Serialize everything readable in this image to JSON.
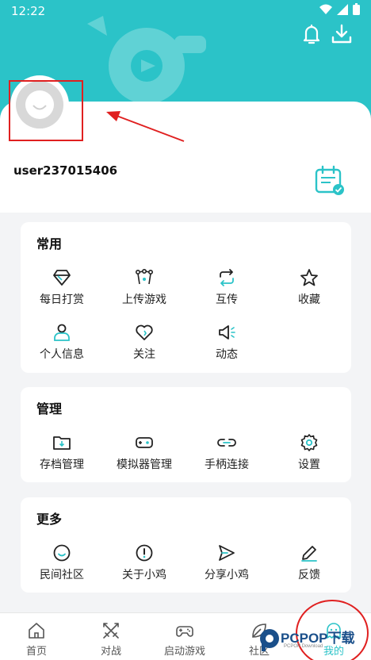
{
  "colors": {
    "accent": "#2bc3c8",
    "annotation_red": "#e02020"
  },
  "status_bar": {
    "time": "12:22"
  },
  "header": {
    "bell_icon": "bell-icon",
    "download_icon": "download-icon"
  },
  "profile": {
    "username": "user237015406",
    "calendar_icon": "calendar-check-icon"
  },
  "sections": {
    "common": {
      "title": "常用",
      "items": [
        {
          "label": "每日打赏",
          "icon": "diamond-icon"
        },
        {
          "label": "上传游戏",
          "icon": "vector-icon"
        },
        {
          "label": "互传",
          "icon": "repeat-icon"
        },
        {
          "label": "收藏",
          "icon": "star-icon"
        },
        {
          "label": "个人信息",
          "icon": "user-icon"
        },
        {
          "label": "关注",
          "icon": "heart-icon"
        },
        {
          "label": "动态",
          "icon": "megaphone-icon"
        }
      ]
    },
    "manage": {
      "title": "管理",
      "items": [
        {
          "label": "存档管理",
          "icon": "folder-icon"
        },
        {
          "label": "模拟器管理",
          "icon": "gamepad-icon"
        },
        {
          "label": "手柄连接",
          "icon": "link-icon"
        },
        {
          "label": "设置",
          "icon": "gear-icon"
        }
      ]
    },
    "more": {
      "title": "更多",
      "items": [
        {
          "label": "民间社区",
          "icon": "smile-icon"
        },
        {
          "label": "关于小鸡",
          "icon": "info-icon"
        },
        {
          "label": "分享小鸡",
          "icon": "send-icon"
        },
        {
          "label": "反馈",
          "icon": "pen-icon"
        }
      ]
    }
  },
  "bottom_nav": [
    {
      "label": "首页",
      "icon": "home-icon"
    },
    {
      "label": "对战",
      "icon": "swords-icon"
    },
    {
      "label": "启动游戏",
      "icon": "gamepad-icon"
    },
    {
      "label": "社区",
      "icon": "leaf-icon"
    },
    {
      "label": "我的",
      "icon": "ghost-icon"
    }
  ],
  "watermark": {
    "title": "PCPOP下载",
    "subtitle": "PCPOP Download"
  }
}
